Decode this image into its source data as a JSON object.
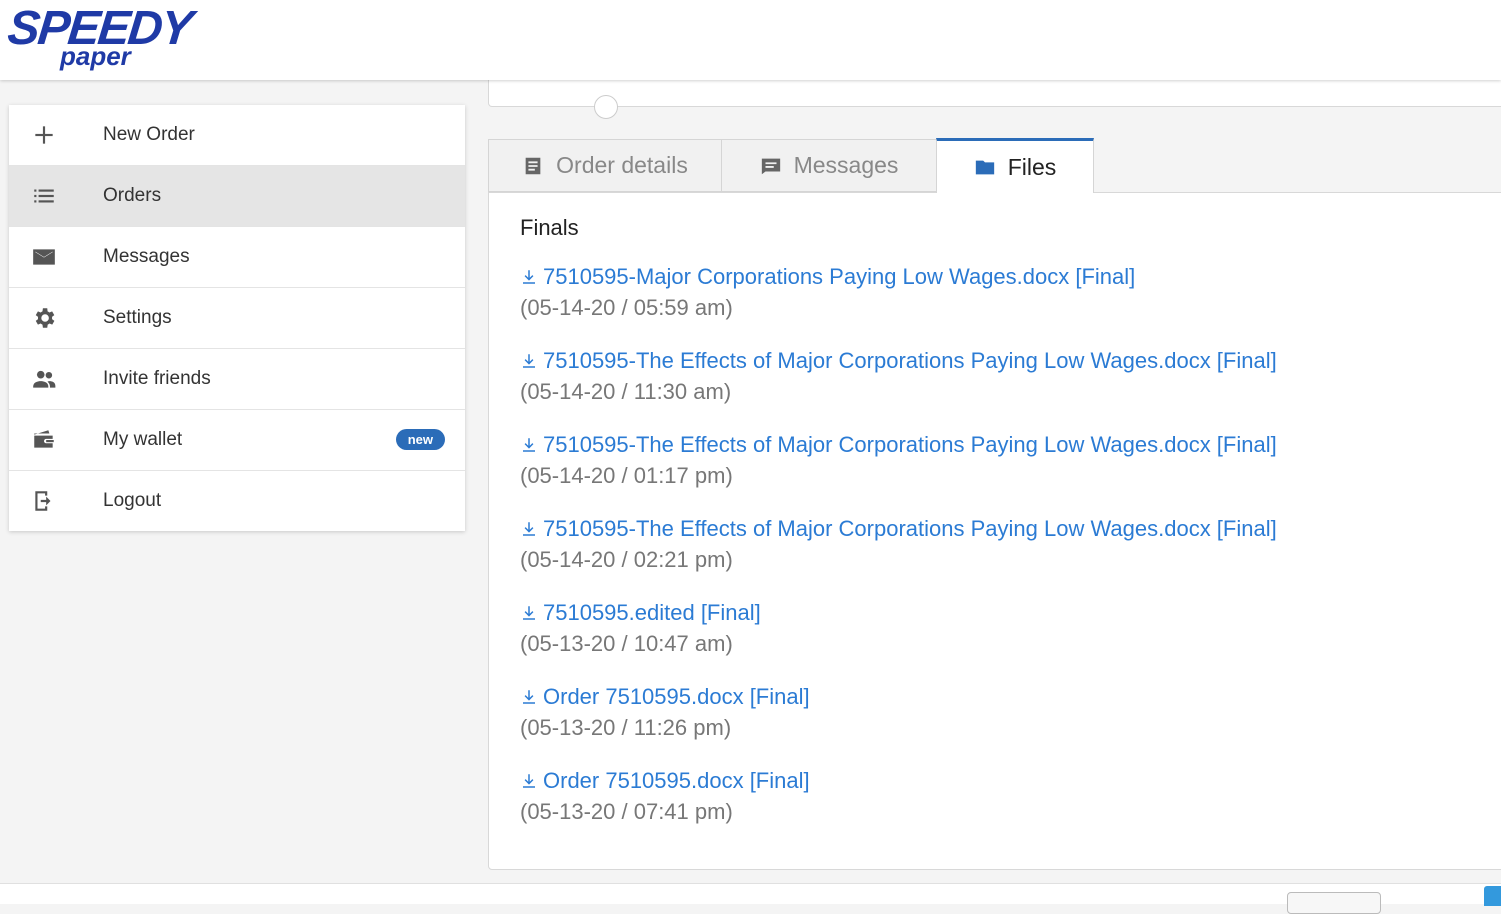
{
  "brand": {
    "logo_text_main": "SPEEDY",
    "logo_text_sub": "paper",
    "color": "#1f3aa6"
  },
  "sidebar": {
    "items": [
      {
        "label": "New Order",
        "icon": "plus-icon"
      },
      {
        "label": "Orders",
        "icon": "list-icon",
        "active": true
      },
      {
        "label": "Messages",
        "icon": "envelope-icon"
      },
      {
        "label": "Settings",
        "icon": "gear-icon"
      },
      {
        "label": "Invite friends",
        "icon": "people-icon"
      },
      {
        "label": "My wallet",
        "icon": "wallet-icon",
        "badge": "new"
      },
      {
        "label": "Logout",
        "icon": "logout-icon"
      }
    ]
  },
  "tabs": [
    {
      "label": "Order details",
      "icon": "document-icon"
    },
    {
      "label": "Messages",
      "icon": "message-icon"
    },
    {
      "label": "Files",
      "icon": "folder-icon",
      "active": true
    }
  ],
  "files": {
    "section_title": "Finals",
    "items": [
      {
        "name": "7510595-Major Corporations Paying Low Wages.docx [Final]",
        "date": "(05-14-20 / 05:59 am)"
      },
      {
        "name": "7510595-The Effects of Major Corporations Paying Low Wages.docx [Final]",
        "date": "(05-14-20 / 11:30 am)"
      },
      {
        "name": "7510595-The Effects of Major Corporations Paying Low Wages.docx [Final]",
        "date": "(05-14-20 / 01:17 pm)"
      },
      {
        "name": "7510595-The Effects of Major Corporations Paying Low Wages.docx [Final]",
        "date": "(05-14-20 / 02:21 pm)"
      },
      {
        "name": "7510595.edited [Final]",
        "date": "(05-13-20 / 10:47 am)"
      },
      {
        "name": "Order 7510595.docx [Final]",
        "date": "(05-13-20 / 11:26 pm)"
      },
      {
        "name": "Order 7510595.docx [Final]",
        "date": "(05-13-20 / 07:41 pm)"
      }
    ]
  },
  "colors": {
    "accent": "#2b6cb8",
    "link": "#2b7bd4"
  }
}
